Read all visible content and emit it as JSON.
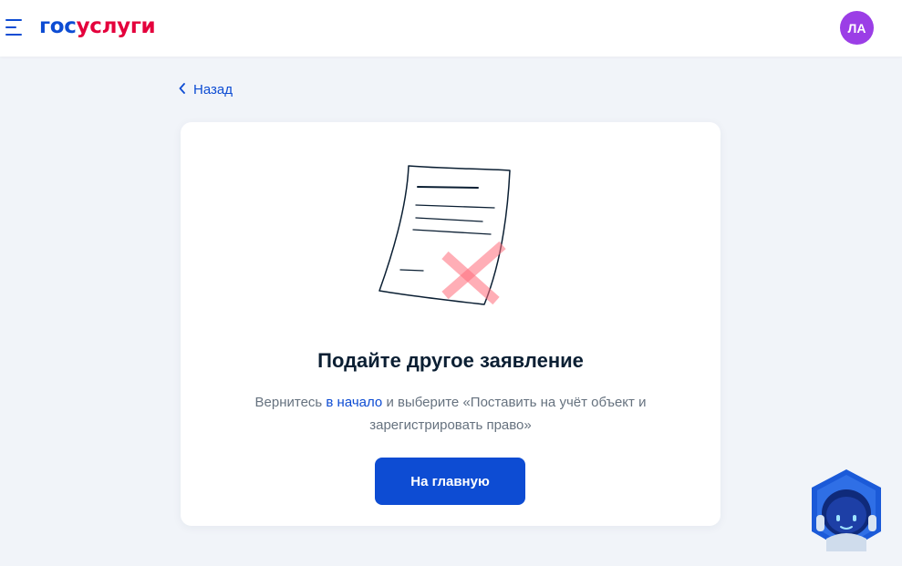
{
  "header": {
    "logo_part1": "гос",
    "logo_part2": "услуги",
    "avatar_initials": "ЛА",
    "menu_icon": "burger-menu-icon"
  },
  "back": {
    "label": "Назад",
    "icon": "chevron-left-icon"
  },
  "card": {
    "illustration": "crossed-document-illustration",
    "title": "Подайте другое заявление",
    "desc_before": "Вернитесь ",
    "desc_link": "в начало",
    "desc_after": " и выберите «Поставить на учёт объект и зарегистрировать право»",
    "button_label": "На главную"
  },
  "assistant": {
    "icon": "robot-assistant-icon"
  },
  "colors": {
    "primary": "#0d4cd3",
    "brand_red": "#e4003c",
    "avatar": "#9b3ee6",
    "background": "#f1f4f9",
    "text": "#0b1f33",
    "muted_text": "#66727f"
  }
}
